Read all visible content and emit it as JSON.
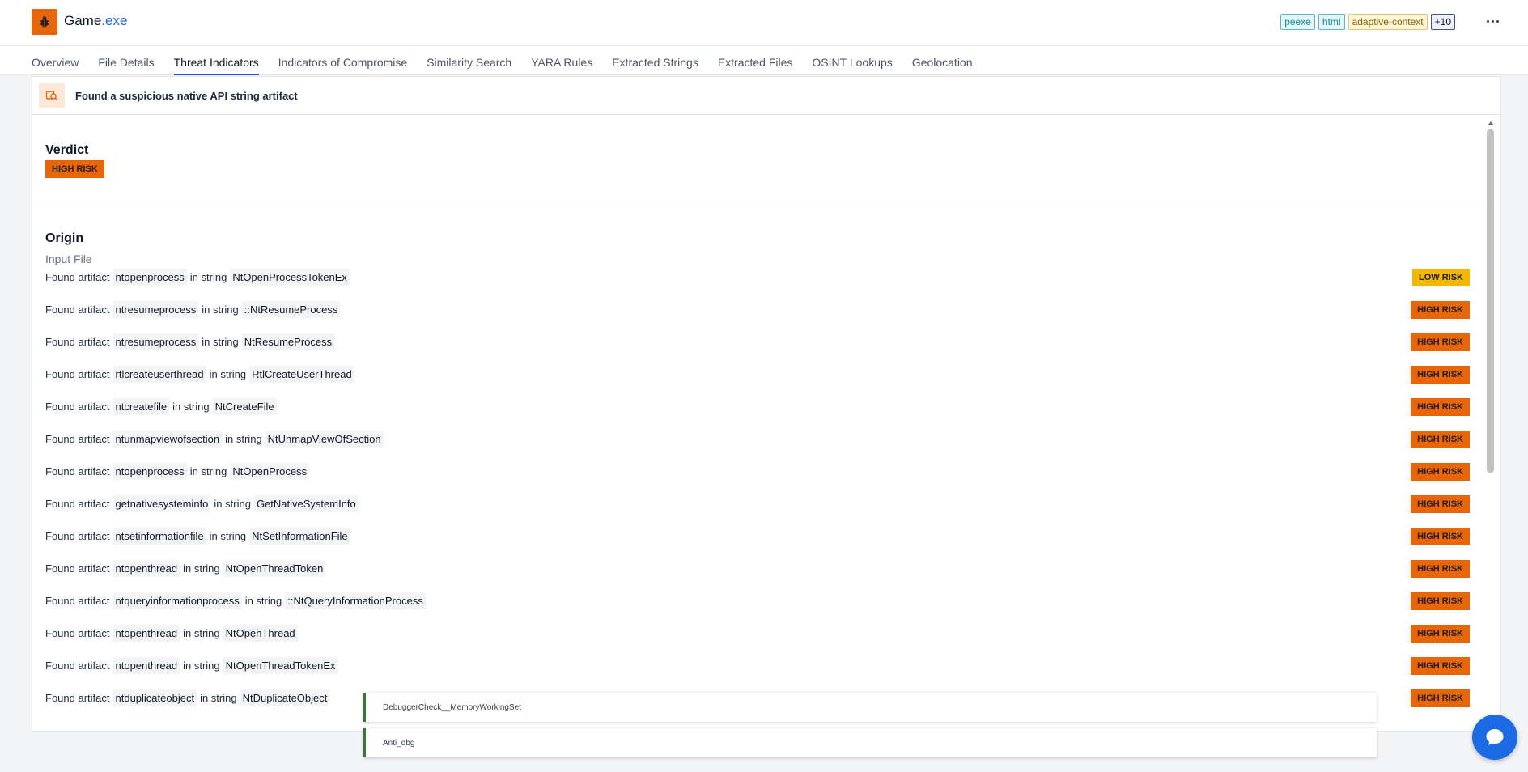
{
  "header": {
    "title_base": "Game",
    "title_ext": ".exe",
    "tags": [
      "peexe",
      "html",
      "adaptive-context",
      "+10"
    ],
    "colors": {
      "brand": "#e8650a",
      "accent": "#2563eb"
    }
  },
  "tabs": [
    "Overview",
    "File Details",
    "Threat Indicators",
    "Indicators of Compromise",
    "Similarity Search",
    "YARA Rules",
    "Extracted Strings",
    "Extracted Files",
    "OSINT Lookups",
    "Geolocation"
  ],
  "active_tab": "Threat Indicators",
  "finding": {
    "title": "Found a suspicious native API string artifact",
    "icon": "api-search-icon"
  },
  "verdict": {
    "label": "Verdict",
    "badge": "HIGH RISK"
  },
  "origin": {
    "label": "Origin",
    "value": "Input File"
  },
  "row_labels": {
    "prefix": "Found artifact",
    "middle": "in string"
  },
  "rows": [
    {
      "artifact": "ntopenprocess",
      "string": "NtOpenProcessTokenEx",
      "risk": "LOW RISK",
      "level": "low"
    },
    {
      "artifact": "ntresumeprocess",
      "string": "::NtResumeProcess",
      "risk": "HIGH RISK",
      "level": "high"
    },
    {
      "artifact": "ntresumeprocess",
      "string": "NtResumeProcess",
      "risk": "HIGH RISK",
      "level": "high"
    },
    {
      "artifact": "rtlcreateuserthread",
      "string": "RtlCreateUserThread",
      "risk": "HIGH RISK",
      "level": "high"
    },
    {
      "artifact": "ntcreatefile",
      "string": "NtCreateFile",
      "risk": "HIGH RISK",
      "level": "high"
    },
    {
      "artifact": "ntunmapviewofsection",
      "string": "NtUnmapViewOfSection",
      "risk": "HIGH RISK",
      "level": "high"
    },
    {
      "artifact": "ntopenprocess",
      "string": "NtOpenProcess",
      "risk": "HIGH RISK",
      "level": "high"
    },
    {
      "artifact": "getnativesysteminfo",
      "string": "GetNativeSystemInfo",
      "risk": "HIGH RISK",
      "level": "high"
    },
    {
      "artifact": "ntsetinformationfile",
      "string": "NtSetInformationFile",
      "risk": "HIGH RISK",
      "level": "high"
    },
    {
      "artifact": "ntopenthread",
      "string": "NtOpenThreadToken",
      "risk": "HIGH RISK",
      "level": "high"
    },
    {
      "artifact": "ntqueryinformationprocess",
      "string": "::NtQueryInformationProcess",
      "risk": "HIGH RISK",
      "level": "high"
    },
    {
      "artifact": "ntopenthread",
      "string": "NtOpenThread",
      "risk": "HIGH RISK",
      "level": "high"
    },
    {
      "artifact": "ntopenthread",
      "string": "NtOpenThreadTokenEx",
      "risk": "HIGH RISK",
      "level": "high"
    },
    {
      "artifact": "ntduplicateobject",
      "string": "NtDuplicateObject",
      "risk": "HIGH RISK",
      "level": "high"
    }
  ],
  "popups": [
    "DebuggerCheck__MemoryWorkingSet",
    "Anti_dbg"
  ]
}
